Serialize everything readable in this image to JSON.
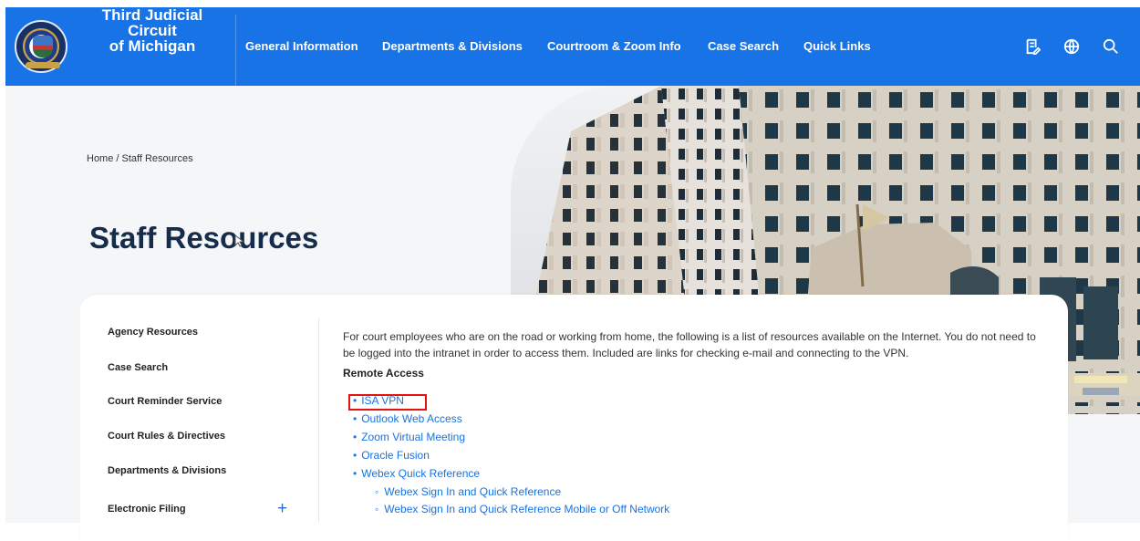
{
  "header": {
    "brand_line_1": "Third Judicial Circuit",
    "brand_line_2": "of Michigan",
    "nav": [
      {
        "label": "General Information"
      },
      {
        "label": "Departments & Divisions"
      },
      {
        "label": "Courtroom & Zoom Info"
      },
      {
        "label": "Case Search"
      },
      {
        "label": "Quick Links"
      }
    ],
    "icons": [
      "forms-icon",
      "globe-icon",
      "search-icon"
    ]
  },
  "hero": {
    "breadcrumb": "Home / Staff Resources",
    "title": "Staff Resources"
  },
  "sidebar": {
    "items": [
      {
        "label": "Agency Resources"
      },
      {
        "label": "Case Search"
      },
      {
        "label": "Court Reminder Service"
      },
      {
        "label": "Court Rules & Directives"
      },
      {
        "label": "Departments & Divisions"
      },
      {
        "label": "Electronic Filing"
      }
    ],
    "expand_label": "+"
  },
  "main": {
    "intro": "For court employees who are on the road or working from home, the following is a list of resources available on the Internet. You do not need to be logged into the intranet in order to access them. Included are links for checking e-mail and connecting to the VPN.",
    "section_title": "Remote Access",
    "links": [
      {
        "label": "ISA VPN"
      },
      {
        "label": "Outlook Web Access"
      },
      {
        "label": "Zoom Virtual Meeting"
      },
      {
        "label": "Oracle Fusion"
      },
      {
        "label": "Webex Quick Reference"
      }
    ],
    "sublinks": [
      {
        "label": "Webex Sign In and Quick Reference"
      },
      {
        "label": "Webex Sign In and Quick Reference Mobile or Off Network"
      }
    ]
  },
  "colors": {
    "header": "#1773e6",
    "link": "#1773e6",
    "title": "#162c4b",
    "highlight": "#e51212"
  }
}
